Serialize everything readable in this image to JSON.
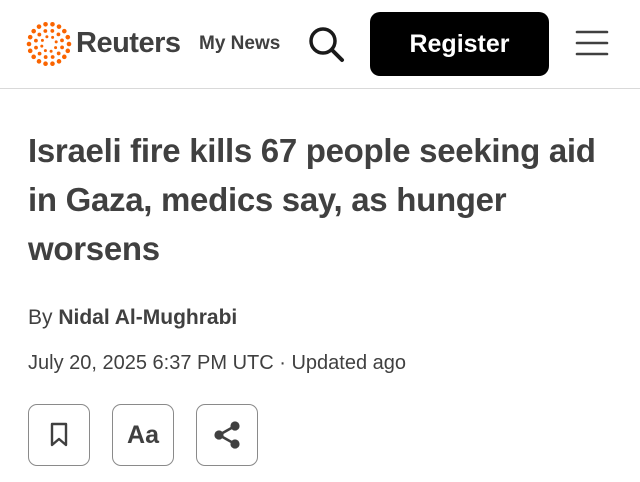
{
  "header": {
    "logo_text": "Reuters",
    "my_news_label": "My News",
    "register_label": "Register",
    "icons": {
      "logo": "reuters-dots-logo",
      "search": "search-icon",
      "menu": "hamburger-menu-icon"
    },
    "logo_color": "#fa6400"
  },
  "article": {
    "headline": "Israeli fire kills 67 people seeking aid in Gaza, medics say, as hunger worsens",
    "byline_prefix": "By",
    "author": "Nidal Al-Mughrabi",
    "dateline": "July 20, 2025 6:37 PM UTC · Updated ago"
  },
  "toolbar": {
    "text_size_label": "Aa",
    "icons": {
      "save": "bookmark-icon",
      "text_size": "text-size-icon",
      "share": "share-icon"
    }
  },
  "colors": {
    "text": "#404040",
    "button_bg": "#000000",
    "button_text": "#ffffff",
    "border": "#8a8a8a"
  }
}
